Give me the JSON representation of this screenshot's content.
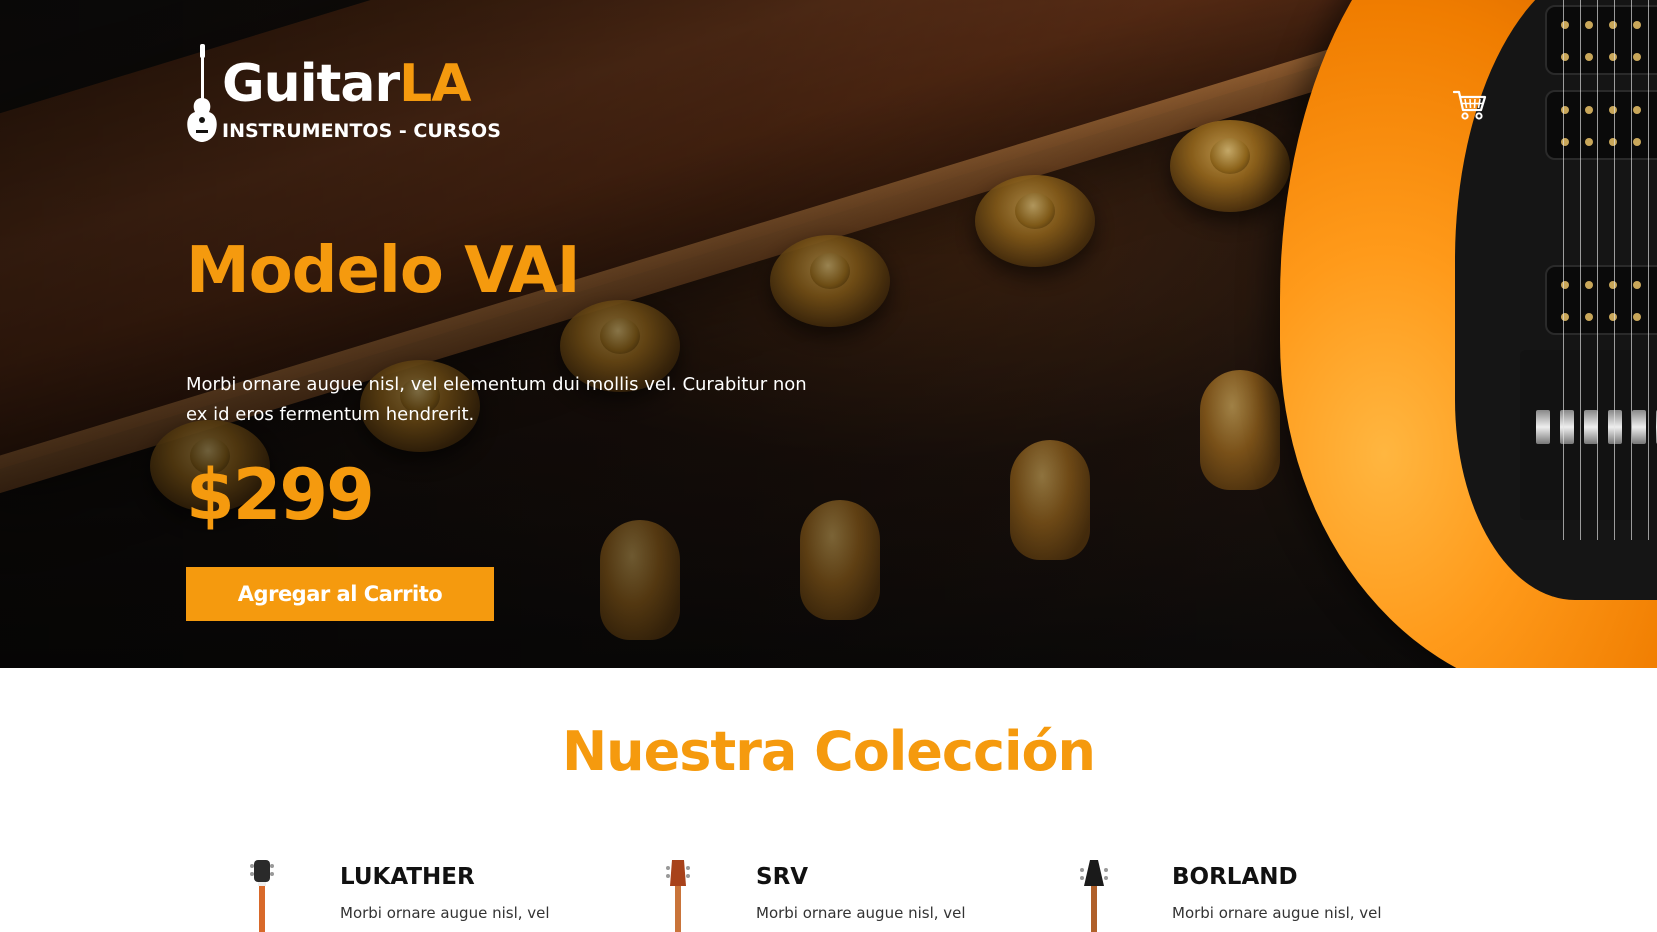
{
  "header": {
    "logo_main": "Guitar",
    "logo_accent": "LA",
    "logo_tagline": "INSTRUMENTOS - CURSOS",
    "cart_icon": "shopping-cart-icon"
  },
  "hero": {
    "title": "Modelo VAI",
    "description": "Morbi ornare augue nisl, vel elementum dui mollis vel. Curabitur non ex id eros fermentum hendrerit.",
    "price": "$299",
    "cta_label": "Agregar al Carrito"
  },
  "collection": {
    "title": "Nuestra Colección",
    "products": [
      {
        "name": "LUKATHER",
        "description": "Morbi ornare augue nisl, vel"
      },
      {
        "name": "SRV",
        "description": "Morbi ornare augue nisl, vel"
      },
      {
        "name": "BORLAND",
        "description": "Morbi ornare augue nisl, vel"
      }
    ]
  },
  "colors": {
    "accent": "#f59a0e",
    "hero_background": "#141210",
    "text_light": "#ffffff",
    "text_dark": "#111111"
  }
}
